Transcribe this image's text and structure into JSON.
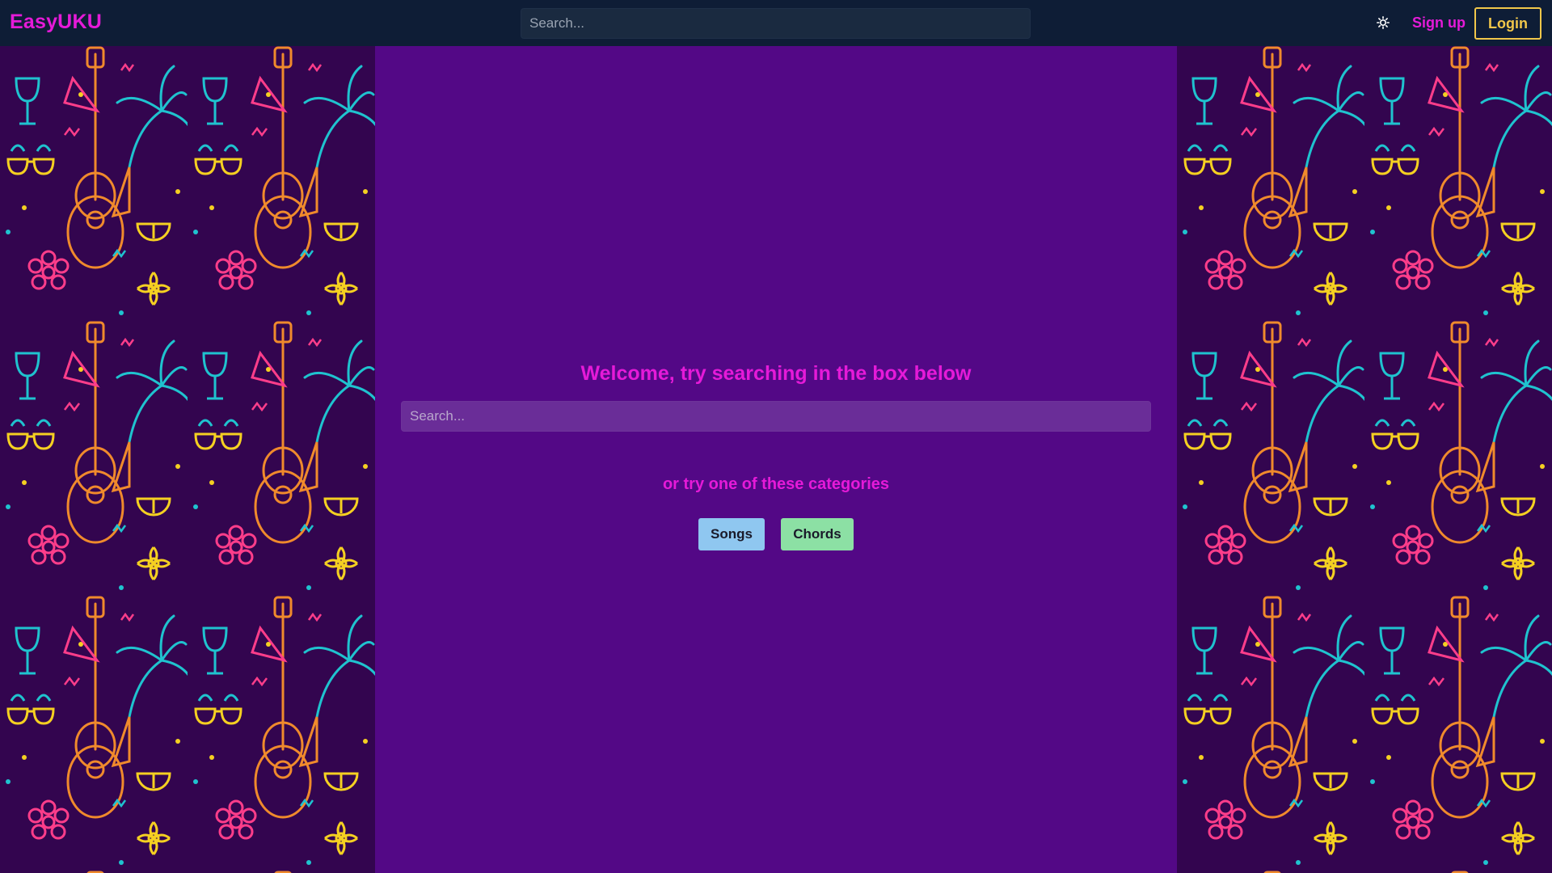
{
  "header": {
    "brand": "EasyUKU",
    "search_placeholder": "Search...",
    "theme_icon": "sun-icon",
    "signup_label": "Sign up",
    "login_label": "Login"
  },
  "main": {
    "welcome": "Welcome, try searching in the box below",
    "search_placeholder": "Search...",
    "categories_prompt": "or try one of these categories",
    "categories": [
      {
        "label": "Songs",
        "color": "#8fc7f0"
      },
      {
        "label": "Chords",
        "color": "#8ce0a4"
      }
    ]
  },
  "colors": {
    "header_bg": "#0e1d36",
    "brand_accent": "#e51ad8",
    "login_border": "#f1c74a",
    "main_bg": "#530886",
    "pattern_bg": "#33054f"
  }
}
